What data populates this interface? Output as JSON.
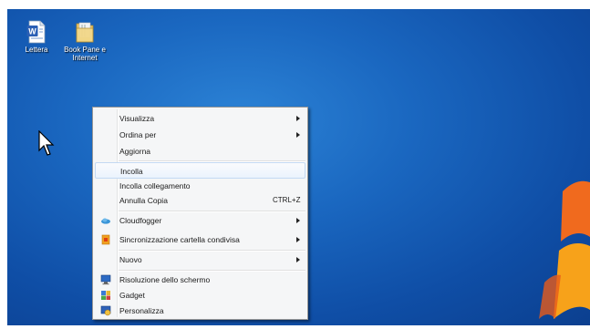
{
  "desktop": {
    "icons": [
      {
        "label": "Lettera",
        "icon": "word-document-icon"
      },
      {
        "label": "Book Pane e Internet",
        "icon": "folder-icon"
      }
    ]
  },
  "context_menu": {
    "items": [
      {
        "label": "Visualizza",
        "submenu": true
      },
      {
        "label": "Ordina per",
        "submenu": true
      },
      {
        "label": "Aggiorna",
        "submenu": false
      },
      {
        "label": "Incolla",
        "submenu": false,
        "highlighted": true
      },
      {
        "label": "Incolla collegamento",
        "submenu": false
      },
      {
        "label": "Annulla Copia",
        "shortcut": "CTRL+Z",
        "submenu": false
      },
      {
        "label": "Cloudfogger",
        "submenu": true,
        "icon": "cloud-icon"
      },
      {
        "label": "Sincronizzazione cartella condivisa",
        "submenu": true,
        "icon": "sync-icon"
      },
      {
        "label": "Nuovo",
        "submenu": true
      },
      {
        "label": "Risoluzione dello schermo",
        "submenu": false,
        "icon": "monitor-icon"
      },
      {
        "label": "Gadget",
        "submenu": false,
        "icon": "gadget-icon"
      },
      {
        "label": "Personalizza",
        "submenu": false,
        "icon": "personalize-icon"
      }
    ]
  },
  "colors": {
    "desktop_bg": "#1a67c0",
    "menu_bg": "#f5f6f7",
    "highlight_border": "#c3d9f3"
  }
}
